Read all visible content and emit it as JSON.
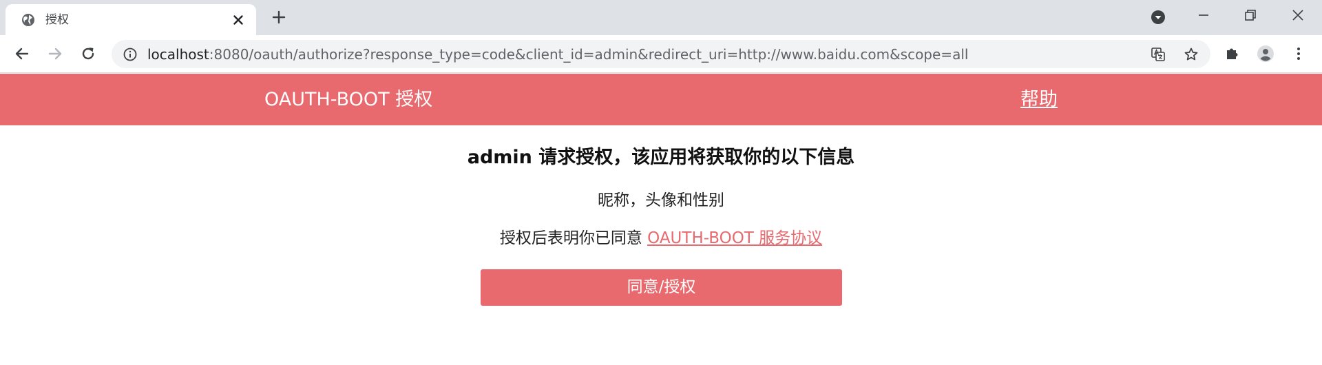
{
  "browser": {
    "tab": {
      "title": "授权",
      "favicon": "globe-icon"
    },
    "address_bar": {
      "host": "localhost",
      "path": ":8080/oauth/authorize?response_type=code&client_id=admin&redirect_uri=http://www.baidu.com&scope=all"
    }
  },
  "header": {
    "brand": "OAUTH-BOOT 授权",
    "help_label": "帮助"
  },
  "main": {
    "heading": "admin 请求授权，该应用将获取你的以下信息",
    "scopes": "昵称，头像和性别",
    "consent_prefix": "授权后表明你已同意 ",
    "agreement_link": "OAUTH-BOOT 服务协议",
    "authorize_label": "同意/授权"
  },
  "colors": {
    "accent": "#e8696e",
    "tab_strip": "#dee1e6",
    "omnibox": "#f1f3f4"
  }
}
